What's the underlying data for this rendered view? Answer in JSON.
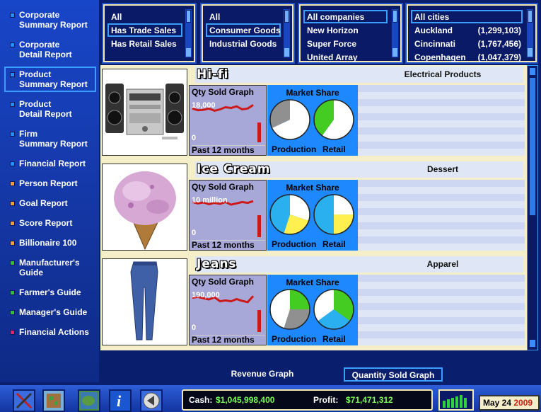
{
  "sidebar": {
    "items": [
      {
        "label": "Corporate\nSummary Report",
        "color": "#1e90ff"
      },
      {
        "label": "Corporate\nDetail Report",
        "color": "#1e90ff"
      },
      {
        "label": "Product\nSummary Report",
        "color": "#1e90ff"
      },
      {
        "label": "Product\nDetail Report",
        "color": "#1e90ff"
      },
      {
        "label": "Firm\nSummary Report",
        "color": "#1e90ff"
      },
      {
        "label": "Financial Report",
        "color": "#1e90ff"
      },
      {
        "label": "Person Report",
        "color": "#f0a030"
      },
      {
        "label": "Goal Report",
        "color": "#f0a030"
      },
      {
        "label": "Score Report",
        "color": "#f0a030"
      },
      {
        "label": "Billionaire 100",
        "color": "#f0a030"
      },
      {
        "label": "Manufacturer's\nGuide",
        "color": "#30c030"
      },
      {
        "label": "Farmer's Guide",
        "color": "#30c030"
      },
      {
        "label": "Manager's Guide",
        "color": "#30c030"
      },
      {
        "label": "Financial Actions",
        "color": "#e8206a"
      }
    ],
    "active_index": 2
  },
  "filters": {
    "sales": {
      "items": [
        "All",
        "Has Trade Sales",
        "Has Retail Sales"
      ],
      "selected": 1
    },
    "goods": {
      "items": [
        "All",
        "Consumer Goods",
        "Industrial Goods"
      ],
      "selected": 1
    },
    "companies": {
      "items": [
        "All companies",
        "New Horizon",
        "Super Force",
        "United Array"
      ],
      "selected": 0
    },
    "cities": {
      "items": [
        {
          "name": "All cities",
          "pop": ""
        },
        {
          "name": "Auckland",
          "pop": "(1,299,103)"
        },
        {
          "name": "Cincinnati",
          "pop": "(1,767,456)"
        },
        {
          "name": "Copenhagen",
          "pop": "(1,047,379)"
        }
      ],
      "selected": 0
    }
  },
  "products": [
    {
      "name": "Hi-fi",
      "category": "Electrical Products",
      "qty_title": "Qty Sold Graph",
      "qty_top": "18,000",
      "qty_zero": "0",
      "qty_footer": "Past 12 months",
      "qty_series": [
        0.77,
        0.73,
        0.74,
        0.77,
        0.72,
        0.75,
        0.8,
        0.78,
        0.82,
        0.75,
        0.77,
        0.85
      ],
      "latest_bar": 0.45,
      "share_title": "Market Share",
      "production_share": [
        {
          "fraction": 0.68,
          "color": "#ffffff"
        },
        {
          "fraction": 0.32,
          "color": "#909090"
        }
      ],
      "retail_share": [
        {
          "fraction": 0.6,
          "color": "#ffffff"
        },
        {
          "fraction": 0.4,
          "color": "#44cc22"
        }
      ],
      "production_label": "Production",
      "retail_label": "Retail"
    },
    {
      "name": "Ice Cream",
      "category": "Dessert",
      "qty_title": "Qty Sold Graph",
      "qty_top": "10 million",
      "qty_zero": "0",
      "qty_footer": "Past 12 months",
      "qty_series": [
        0.8,
        0.77,
        0.79,
        0.75,
        0.78,
        0.76,
        0.8,
        0.74,
        0.77,
        0.8,
        0.78,
        0.82
      ],
      "latest_bar": 0.5,
      "share_title": "Market Share",
      "production_share": [
        {
          "fraction": 0.3,
          "color": "#ffffff"
        },
        {
          "fraction": 0.25,
          "color": "#fff050"
        },
        {
          "fraction": 0.45,
          "color": "#2ab0ee"
        }
      ],
      "retail_share": [
        {
          "fraction": 0.25,
          "color": "#ffffff"
        },
        {
          "fraction": 0.25,
          "color": "#fff050"
        },
        {
          "fraction": 0.5,
          "color": "#2ab0ee"
        }
      ],
      "production_label": "Production",
      "retail_label": "Retail"
    },
    {
      "name": "Jeans",
      "category": "Apparel",
      "qty_title": "Qty Sold Graph",
      "qty_top": "190,000",
      "qty_zero": "0",
      "qty_footer": "Past 12 months",
      "qty_series": [
        0.78,
        0.8,
        0.77,
        0.74,
        0.79,
        0.7,
        0.72,
        0.7,
        0.75,
        0.71,
        0.68,
        0.82
      ],
      "latest_bar": 0.5,
      "share_title": "Market Share",
      "production_share": [
        {
          "fraction": 0.25,
          "color": "#44cc22"
        },
        {
          "fraction": 0.3,
          "color": "#909090"
        },
        {
          "fraction": 0.45,
          "color": "#ffffff"
        }
      ],
      "retail_share": [
        {
          "fraction": 0.35,
          "color": "#44cc22"
        },
        {
          "fraction": 0.3,
          "color": "#2ab0ee"
        },
        {
          "fraction": 0.35,
          "color": "#ffffff"
        }
      ],
      "production_label": "Production",
      "retail_label": "Retail"
    }
  ],
  "graph_tabs": {
    "revenue": "Revenue Graph",
    "quantity": "Quantity Sold Graph",
    "active": "quantity"
  },
  "status": {
    "cash_label": "Cash:",
    "cash_value": "$1,045,998,400",
    "profit_label": "Profit:",
    "profit_value": "$71,471,312",
    "value_color": "#7cfc5a"
  },
  "date": {
    "day": "May 24",
    "year": "2009",
    "year_color": "#d02010"
  },
  "toolbar": {
    "icons": [
      "tools-icon",
      "map-grid-icon",
      "world-map-icon",
      "info-icon",
      "back-icon"
    ]
  },
  "colors": {
    "graph_line": "#cc1a1a",
    "accent": "#3aa0ff"
  }
}
